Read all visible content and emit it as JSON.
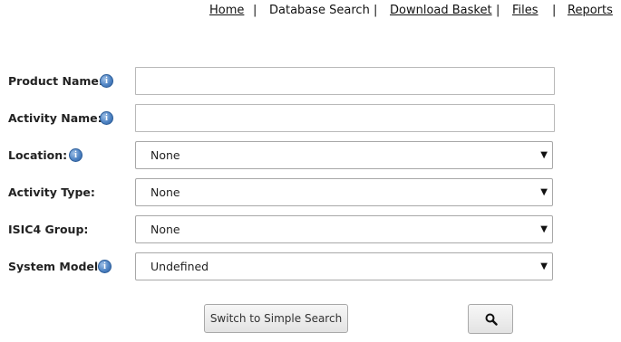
{
  "nav": {
    "home": "Home",
    "database_search": "Database Search",
    "download_basket": "Download Basket",
    "files": "Files",
    "reports": "Reports",
    "separator": "|"
  },
  "form": {
    "product_name": {
      "label": "Product Name:",
      "value": "",
      "info_icon": "info-icon"
    },
    "activity_name": {
      "label": "Activity Name:",
      "value": "",
      "info_icon": "info-icon"
    },
    "location": {
      "label": "Location:",
      "selected": "None",
      "info_icon": "info-icon"
    },
    "activity_type": {
      "label": "Activity Type:",
      "selected": "None"
    },
    "isic4_group": {
      "label": "ISIC4 Group:",
      "selected": "None"
    },
    "system_model": {
      "label": "System Model:",
      "selected": "Undefined",
      "info_icon": "info-icon"
    }
  },
  "buttons": {
    "switch_simple": "Switch to Simple Search",
    "search_icon": "search-icon"
  },
  "icons": {
    "info_glyph": "i",
    "dropdown_glyph": "▼"
  },
  "colors": {
    "info_icon": "#4f84c4",
    "input_border": "#b9b9b9"
  }
}
